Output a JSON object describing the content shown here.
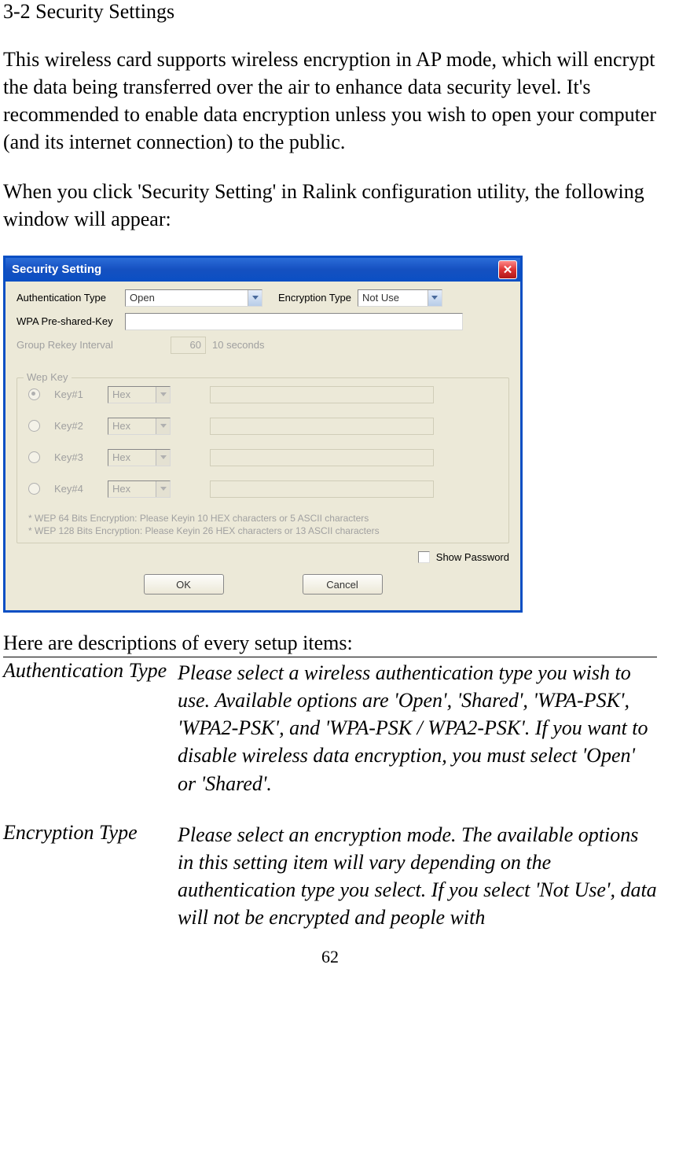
{
  "heading": "3-2 Security Settings",
  "para1": "This wireless card supports wireless encryption in AP mode, which will encrypt the data being transferred over the air to enhance data security level. It's recommended to enable data encryption unless you wish to open your computer (and its internet connection) to the public.",
  "para2": "When you click 'Security Setting' in Ralink configuration utility, the following window will appear:",
  "dialog": {
    "title": "Security Setting",
    "auth_type_label": "Authentication Type",
    "auth_type_value": "Open",
    "enc_type_label": "Encryption Type",
    "enc_type_value": "Not Use",
    "psk_label": "WPA Pre-shared-Key",
    "rekey_label": "Group Rekey Interval",
    "rekey_value": "60",
    "rekey_unit": "10 seconds",
    "wep_legend": "Wep Key",
    "keys": [
      {
        "label": "Key#1",
        "fmt": "Hex",
        "selected": true
      },
      {
        "label": "Key#2",
        "fmt": "Hex",
        "selected": false
      },
      {
        "label": "Key#3",
        "fmt": "Hex",
        "selected": false
      },
      {
        "label": "Key#4",
        "fmt": "Hex",
        "selected": false
      }
    ],
    "hint1": "* WEP 64 Bits Encryption:  Please Keyin 10 HEX characters or 5 ASCII characters",
    "hint2": "* WEP 128 Bits Encryption:  Please Keyin 26 HEX characters or 13 ASCII characters",
    "show_pw_label": "Show Password",
    "ok_label": "OK",
    "cancel_label": "Cancel"
  },
  "desc_intro": "Here are descriptions of every setup items:",
  "desc_items": [
    {
      "term": "Authentication Type",
      "def": "Please select a wireless authentication type you wish to use. Available options are 'Open', 'Shared', 'WPA-PSK', 'WPA2-PSK', and 'WPA-PSK / WPA2-PSK'. If you want to disable wireless data encryption, you must select 'Open' or 'Shared'."
    },
    {
      "term": "Encryption Type",
      "def": "Please select an encryption mode. The available options in this setting item will vary depending on the authentication type you select. If you select 'Not Use', data will not be encrypted and people with"
    }
  ],
  "page_num": "62"
}
